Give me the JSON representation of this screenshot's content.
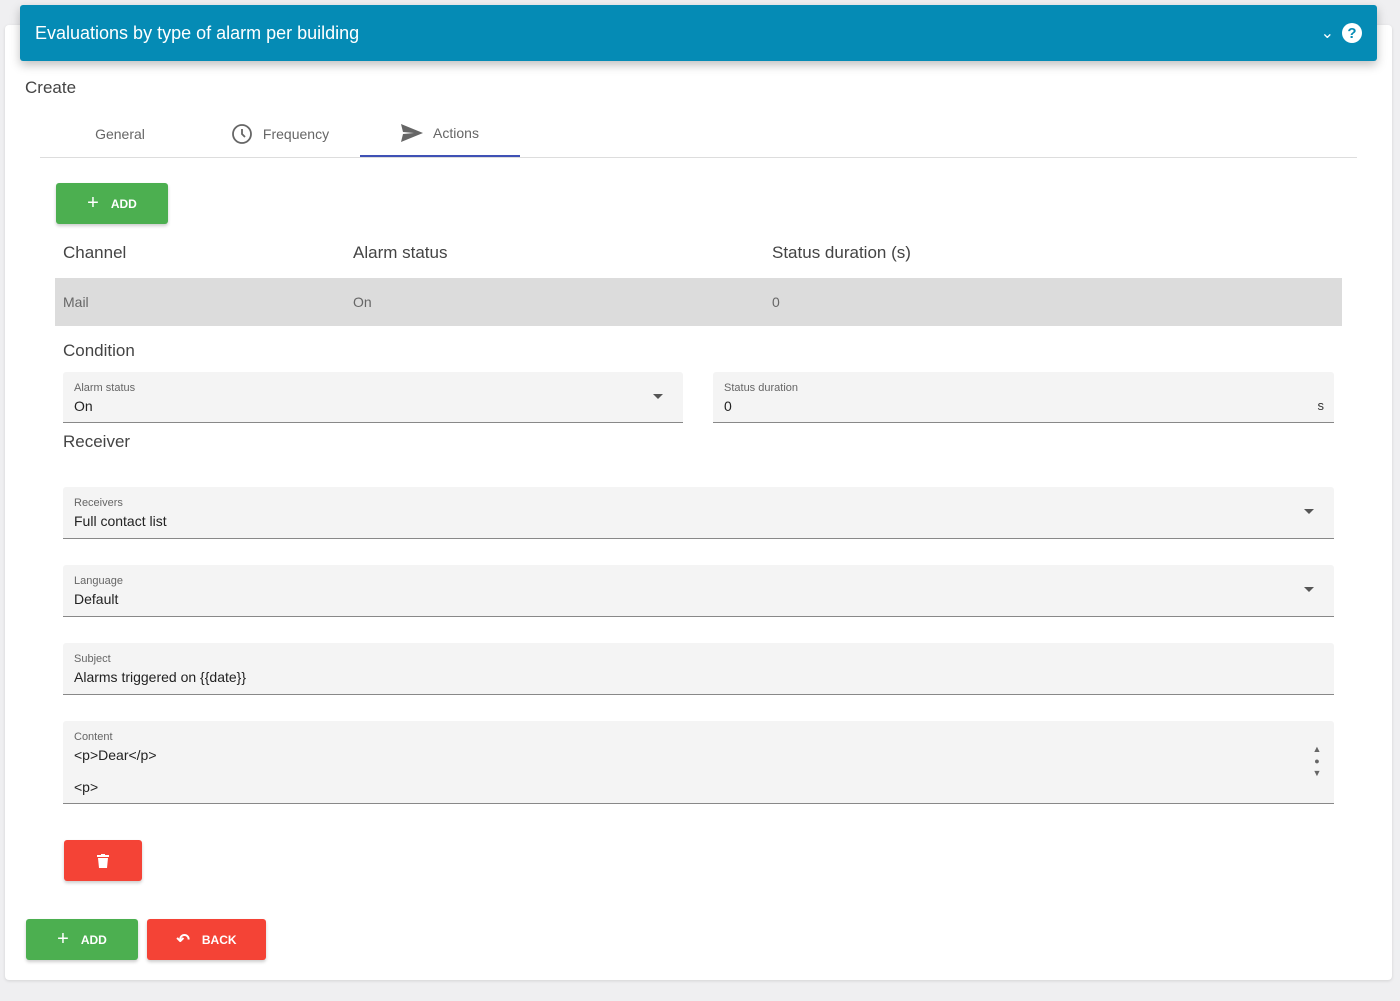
{
  "header": {
    "title": "Evaluations by type of alarm per building",
    "colors": {
      "bar": "#058bb5"
    }
  },
  "page": {
    "subtitle": "Create"
  },
  "tabs": [
    {
      "label": "General"
    },
    {
      "label": "Frequency",
      "icon": "clock-icon"
    },
    {
      "label": "Actions",
      "icon": "send-icon",
      "active": true
    }
  ],
  "actions": {
    "add_label": "ADD"
  },
  "table": {
    "headers": [
      "Channel",
      "Alarm status",
      "Status duration (s)"
    ],
    "rows": [
      [
        "Mail",
        "On",
        "0"
      ]
    ]
  },
  "condition": {
    "title": "Condition",
    "alarm_status": {
      "label": "Alarm status",
      "value": "On"
    },
    "status_duration": {
      "label": "Status duration",
      "value": "0",
      "suffix": "s"
    }
  },
  "receiver": {
    "title": "Receiver",
    "receivers": {
      "label": "Receivers",
      "value": "Full contact list"
    },
    "language": {
      "label": "Language",
      "value": "Default"
    },
    "subject": {
      "label": "Subject",
      "value": "Alarms triggered on {{date}}"
    },
    "content": {
      "label": "Content",
      "value": "<p>Dear</p>\n\n<p>"
    }
  },
  "footer": {
    "add_label": "ADD",
    "back_label": "BACK"
  }
}
